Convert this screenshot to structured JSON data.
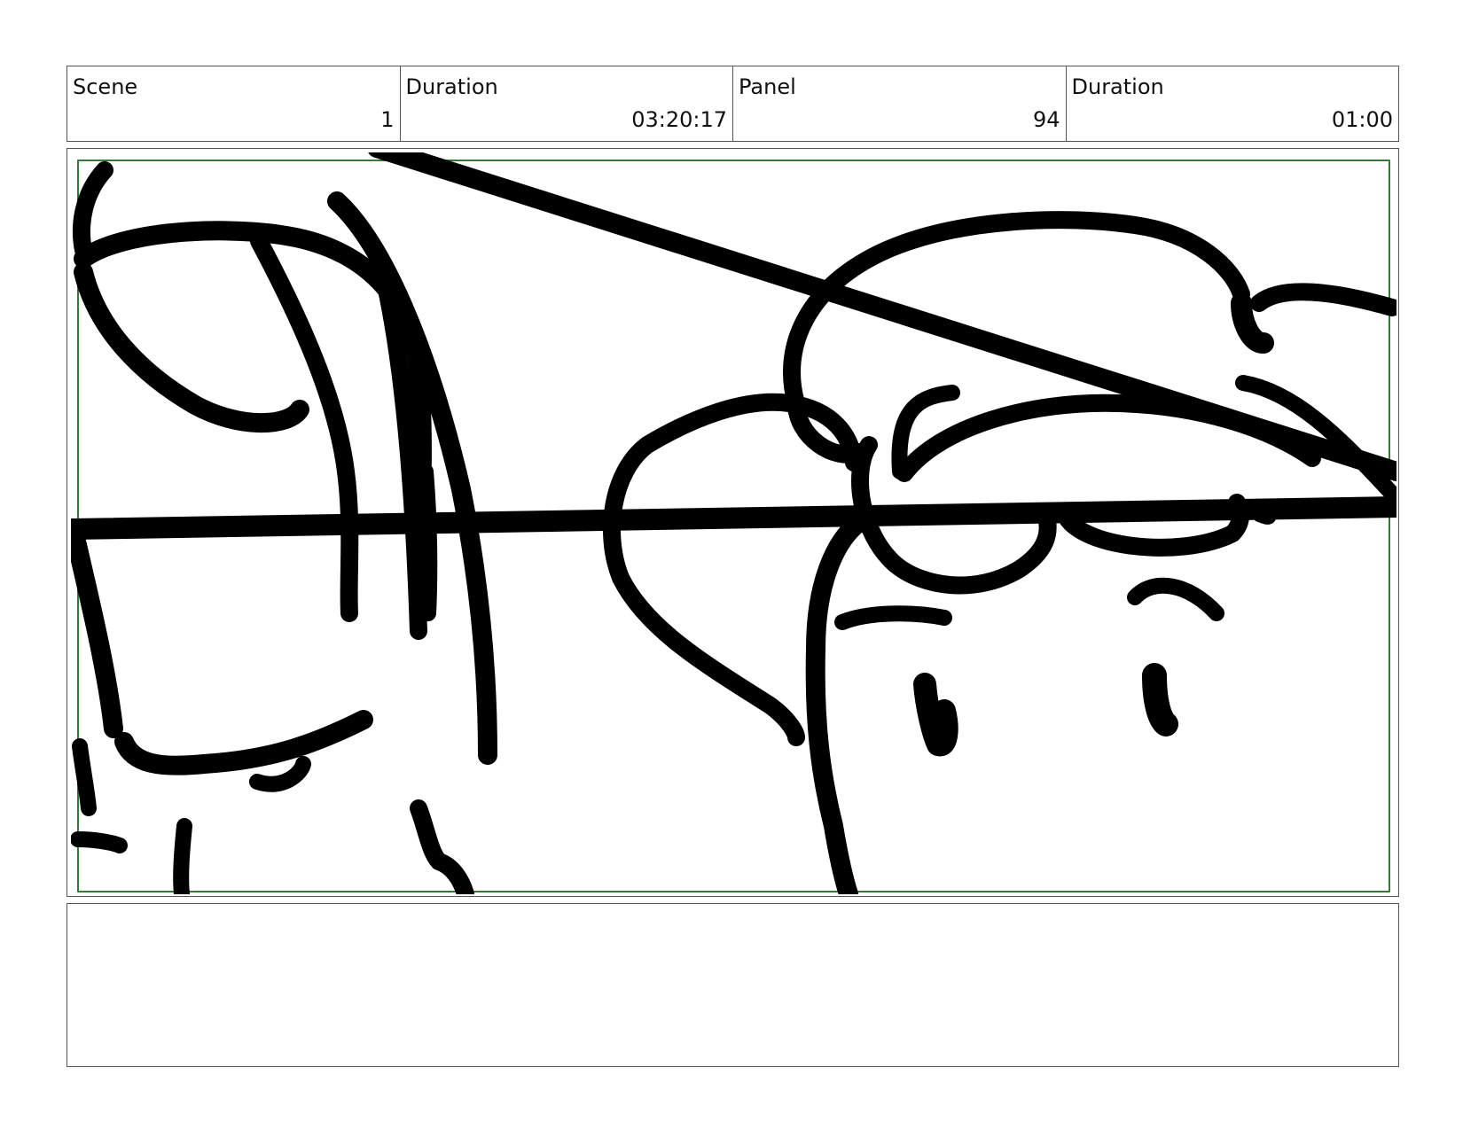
{
  "header": {
    "scene_label": "Scene",
    "scene_value": "1",
    "scene_duration_label": "Duration",
    "scene_duration_value": "03:20:17",
    "panel_label": "Panel",
    "panel_value": "94",
    "panel_duration_label": "Duration",
    "panel_duration_value": "01:00"
  },
  "panel": {
    "safe_frame_color": "#2e7d32",
    "stroke_color": "#000000"
  },
  "notes": {
    "text": ""
  }
}
